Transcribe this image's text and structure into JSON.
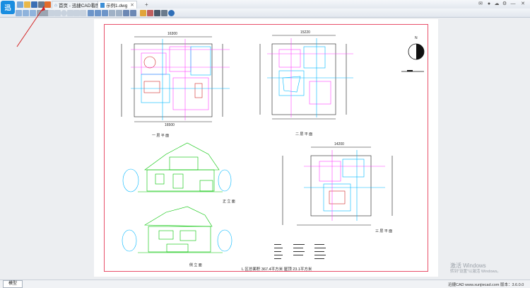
{
  "app": {
    "logo_text": "迅"
  },
  "tabs": [
    {
      "label": "首页 - 迅捷CAD看图",
      "icon": "home-icon",
      "active": false
    },
    {
      "label": "示例1.dwg",
      "icon": "dwg-file-icon",
      "active": true
    }
  ],
  "window_controls": {
    "close": "✕",
    "min": "—"
  },
  "drawing": {
    "dim_top_1": "16300",
    "dim_top_2": "15220",
    "dim_top_3": "14200",
    "dim_bottom_1": "16500",
    "title_floor1": "一 层 平 面",
    "title_floor2": "二 层 平 面",
    "title_floor3": "三 层 平 面",
    "title_south": "正 立 面",
    "title_side": "侧 立 面",
    "area_note": "L 区总面积   367.4平方米    屋顶 23.1平方米",
    "compass_label": "N"
  },
  "status": {
    "model_tab": "模型"
  },
  "watermark": {
    "line1": "激活 Windows",
    "line2": "转到\"设置\"以激活 Windows。"
  },
  "footer": {
    "text": "迅捷CAD  www.xunjiecad.com  版本：3.6.0.0"
  }
}
